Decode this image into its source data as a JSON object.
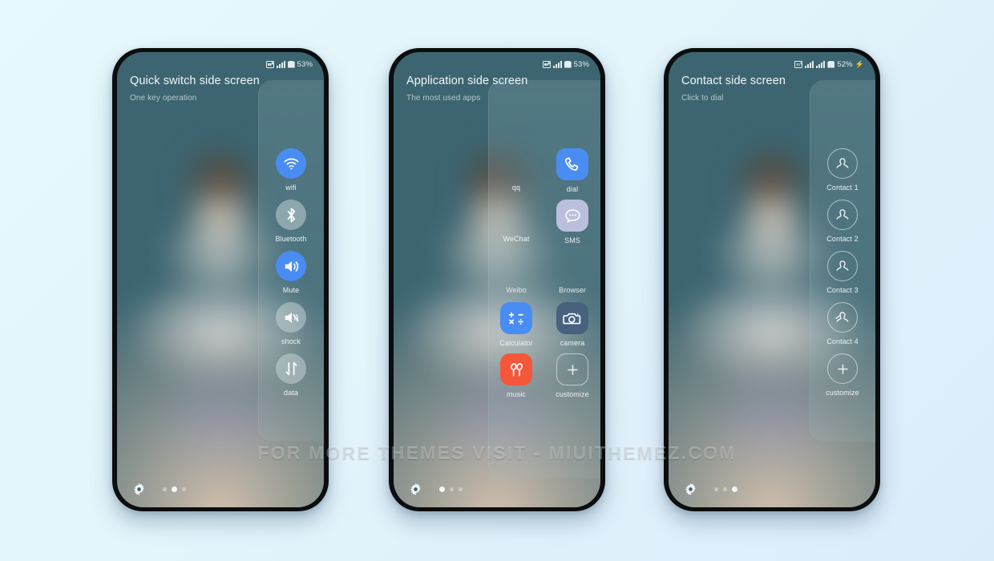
{
  "watermark": "FOR MORE THEMES VISIT - MIUITHEMEZ.COM",
  "colors": {
    "accent_blue": "#4a8df2",
    "tile_grey": "#c8d4d8",
    "tile_lavender": "#b9bfdd",
    "tile_dark": "#46627e",
    "tile_red": "#f4573a",
    "screen_teal": "#3c6571",
    "page_bg_start": "#e6f9fc",
    "page_bg_end": "#dcebfa"
  },
  "phones": [
    {
      "id": "quick-switch",
      "status": {
        "battery": "53%",
        "charging": false,
        "dual_sim": false
      },
      "header": {
        "title": "Quick switch side screen",
        "subtitle": "One key operation"
      },
      "items": [
        {
          "label": "wifi",
          "icon": "wifi-icon",
          "style": "t-blue"
        },
        {
          "label": "Bluetooth",
          "icon": "bluetooth-icon",
          "style": "t-grey"
        },
        {
          "label": "Mute",
          "icon": "volume-icon",
          "style": "t-blue"
        },
        {
          "label": "shock",
          "icon": "vibrate-icon",
          "style": "t-grey"
        },
        {
          "label": "data",
          "icon": "data-icon",
          "style": "t-grey"
        }
      ],
      "dots": {
        "count": 3,
        "active": 1
      }
    },
    {
      "id": "application",
      "status": {
        "battery": "53%",
        "charging": false,
        "dual_sim": false
      },
      "header": {
        "title": "Application side screen",
        "subtitle": "The most used apps"
      },
      "items": [
        {
          "label": "qq",
          "icon": "qq-icon",
          "style": "t-none"
        },
        {
          "label": "dial",
          "icon": "phone-icon",
          "style": "t-blue"
        },
        {
          "label": "WeChat",
          "icon": "wechat-icon",
          "style": "t-none"
        },
        {
          "label": "SMS",
          "icon": "message-icon",
          "style": "t-lav"
        },
        {
          "label": "Weibo",
          "icon": "weibo-icon",
          "style": "t-none"
        },
        {
          "label": "Browser",
          "icon": "browser-icon",
          "style": "t-none"
        },
        {
          "label": "Calculator",
          "icon": "calculator-icon",
          "style": "t-blue"
        },
        {
          "label": "camera",
          "icon": "camera-icon",
          "style": "t-dark"
        },
        {
          "label": "music",
          "icon": "earbuds-icon",
          "style": "t-red"
        },
        {
          "label": "customize",
          "icon": "plus-icon",
          "style": "t-ghost"
        }
      ],
      "dots": {
        "count": 3,
        "active": 0
      }
    },
    {
      "id": "contact",
      "status": {
        "battery": "52%",
        "charging": true,
        "dual_sim": true
      },
      "header": {
        "title": "Contact side screen",
        "subtitle": "Click to dial"
      },
      "items": [
        {
          "label": "Contact 1",
          "icon": "contact-avatar-icon",
          "style": "t-ghost-round"
        },
        {
          "label": "Contact 2",
          "icon": "contact-avatar-icon",
          "style": "t-ghost-round"
        },
        {
          "label": "Contact 3",
          "icon": "contact-avatar-icon",
          "style": "t-ghost-round"
        },
        {
          "label": "Contact 4",
          "icon": "contact-avatar-icon",
          "style": "t-ghost-round"
        },
        {
          "label": "customize",
          "icon": "plus-icon",
          "style": "t-ghost-round"
        }
      ],
      "dots": {
        "count": 3,
        "active": 2
      }
    }
  ]
}
